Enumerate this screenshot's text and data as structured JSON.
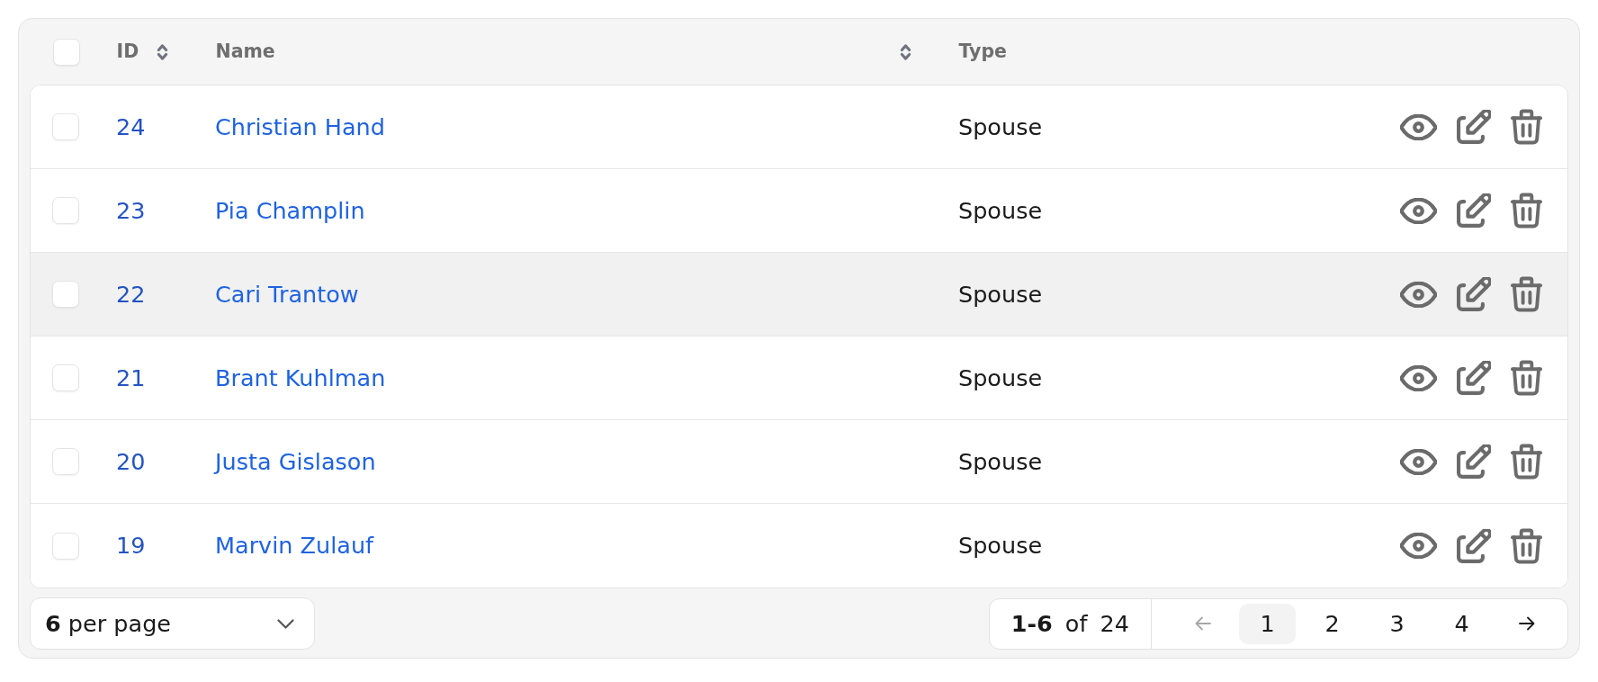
{
  "table": {
    "select_all": {
      "checked": false
    },
    "columns": [
      {
        "label": "ID",
        "sortable": true
      },
      {
        "label": "Name",
        "sortable": true
      },
      {
        "label": "Type",
        "sortable": false
      }
    ],
    "rows": [
      {
        "checked": false,
        "highlighted": false,
        "id": "24",
        "name": "Christian Hand",
        "type": "Spouse"
      },
      {
        "checked": false,
        "highlighted": false,
        "id": "23",
        "name": "Pia Champlin",
        "type": "Spouse"
      },
      {
        "checked": false,
        "highlighted": true,
        "id": "22",
        "name": "Cari Trantow",
        "type": "Spouse"
      },
      {
        "checked": false,
        "highlighted": false,
        "id": "21",
        "name": "Brant Kuhlman",
        "type": "Spouse"
      },
      {
        "checked": false,
        "highlighted": false,
        "id": "20",
        "name": "Justa Gislason",
        "type": "Spouse"
      },
      {
        "checked": false,
        "highlighted": false,
        "id": "19",
        "name": "Marvin Zulauf",
        "type": "Spouse"
      }
    ]
  },
  "footer": {
    "per_page": {
      "label": "**6** per page"
    },
    "range": "**1-6** of 24",
    "pagination": {
      "previous": {
        "disabled": true
      },
      "pages": [
        {
          "label": "1",
          "selected": true
        },
        {
          "label": "2",
          "selected": false
        },
        {
          "label": "3",
          "selected": false
        },
        {
          "label": "4",
          "selected": false
        }
      ],
      "next": {
        "disabled": false
      }
    }
  }
}
